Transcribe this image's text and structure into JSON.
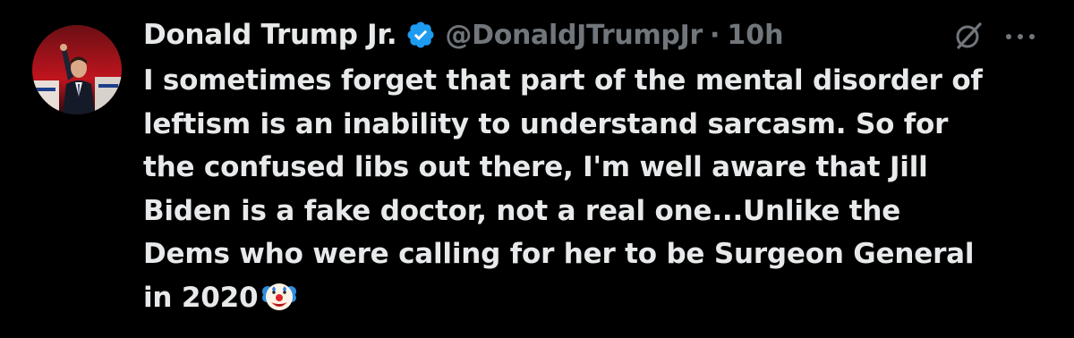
{
  "tweet": {
    "author_name": "Donald Trump Jr.",
    "handle": "@DonaldJTrumpJr",
    "separator": "·",
    "time": "10h",
    "text_lines": [
      "I sometimes forget that part of the mental disorder of",
      "leftism is an inability to understand sarcasm. So for",
      "the confused libs out there, I'm well aware that Jill",
      "Biden is a fake doctor, not a real one...Unlike the",
      "Dems who were calling for her to be Surgeon General",
      "in 2020"
    ],
    "verified": true,
    "trailing_emoji": "clown-face"
  },
  "icons": {
    "verified": "verified-badge-icon",
    "grok": "grok-icon",
    "more": "more-options-icon",
    "emoji": "clown-face-emoji"
  },
  "colors": {
    "background": "#000000",
    "text_primary": "#e7e9ea",
    "text_secondary": "#71767b",
    "verified_blue": "#1d9bf0"
  }
}
